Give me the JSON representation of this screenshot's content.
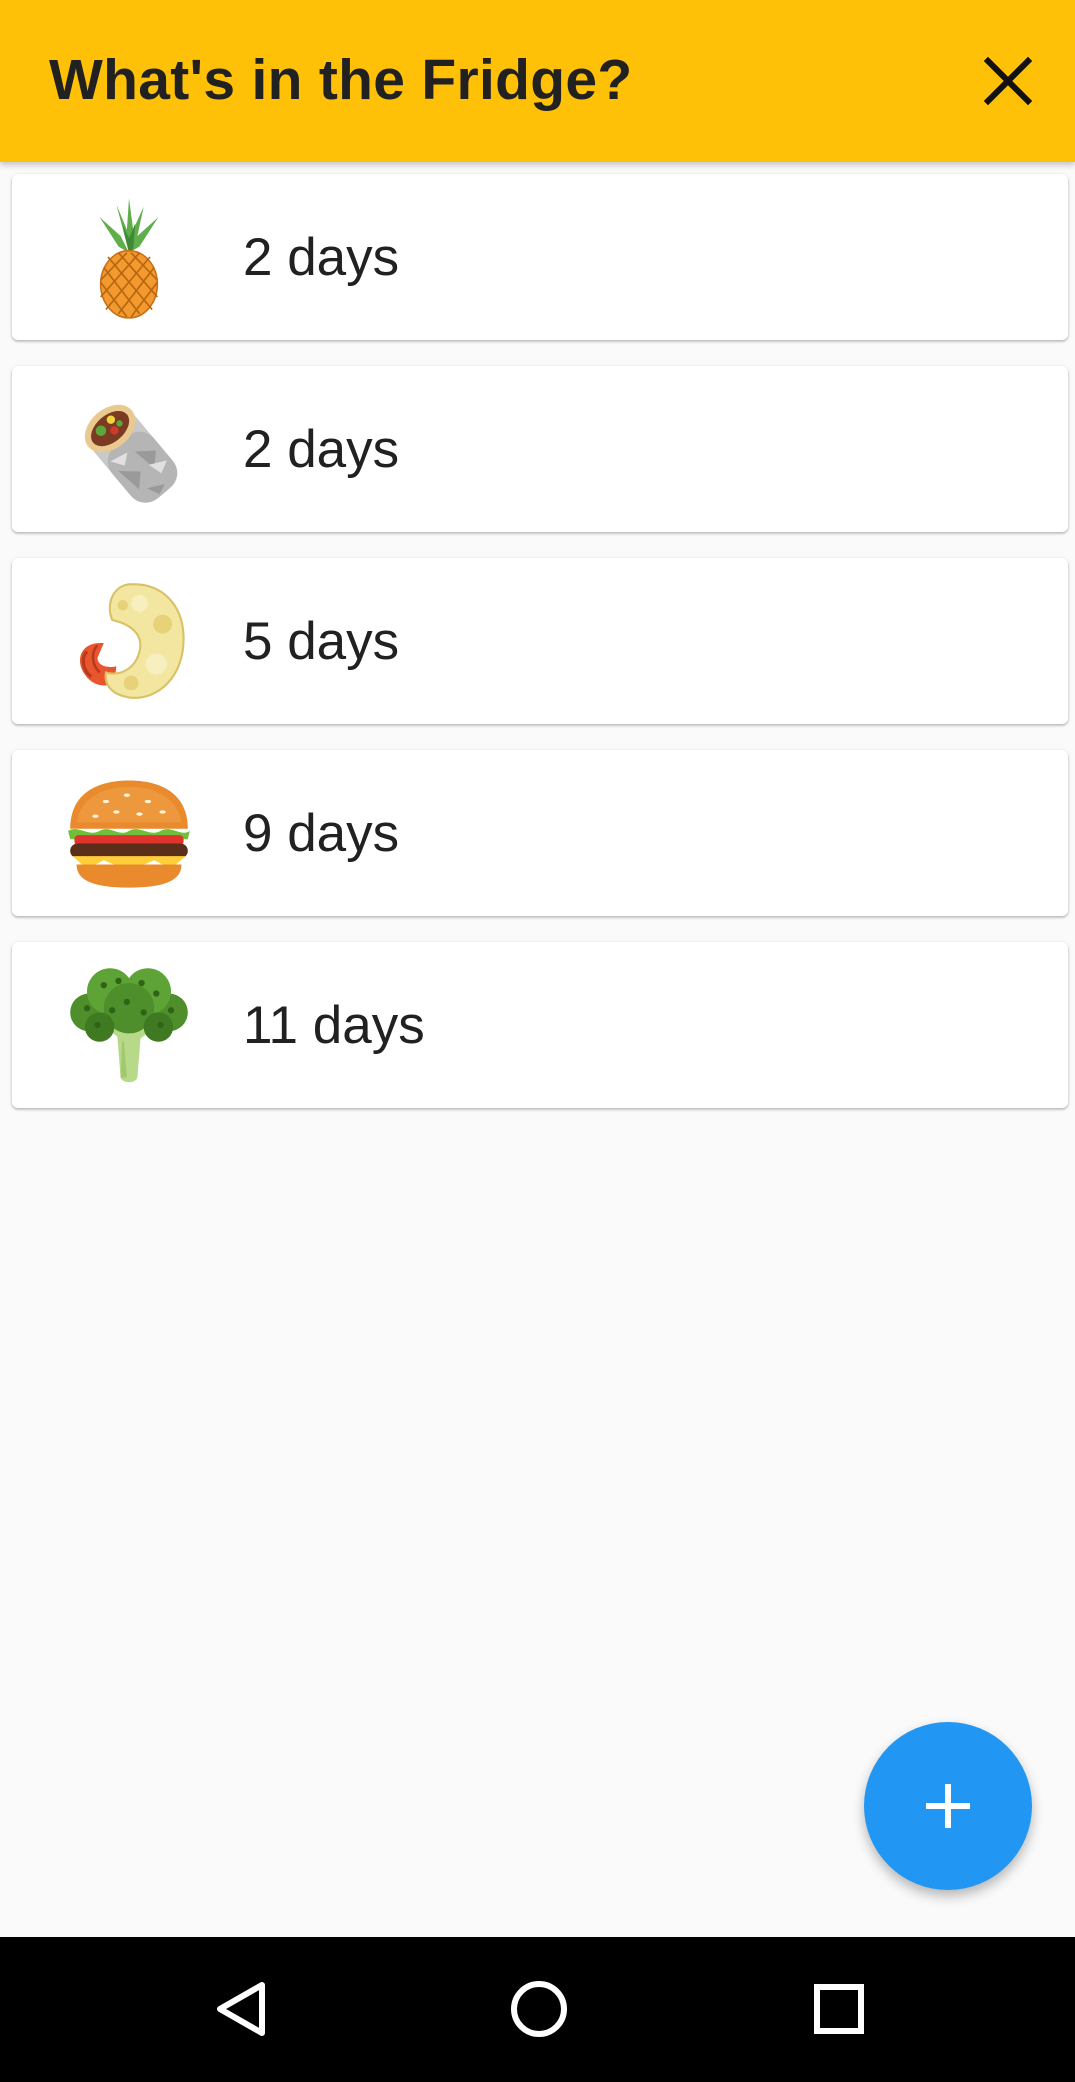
{
  "app_bar": {
    "title": "What's in the Fridge?",
    "background": "#ffc107",
    "close_icon": "close-icon"
  },
  "items": [
    {
      "icon": "pineapple-icon",
      "label": "2 days"
    },
    {
      "icon": "burrito-icon",
      "label": "2 days"
    },
    {
      "icon": "fried-shrimp-icon",
      "label": "5 days"
    },
    {
      "icon": "hamburger-icon",
      "label": "9 days"
    },
    {
      "icon": "broccoli-icon",
      "label": "11 days"
    }
  ],
  "fab": {
    "icon": "plus-icon",
    "color": "#2196f3"
  },
  "navigation": {
    "back_icon": "back-triangle-icon",
    "home_icon": "home-circle-icon",
    "recents_icon": "recents-square-icon"
  }
}
